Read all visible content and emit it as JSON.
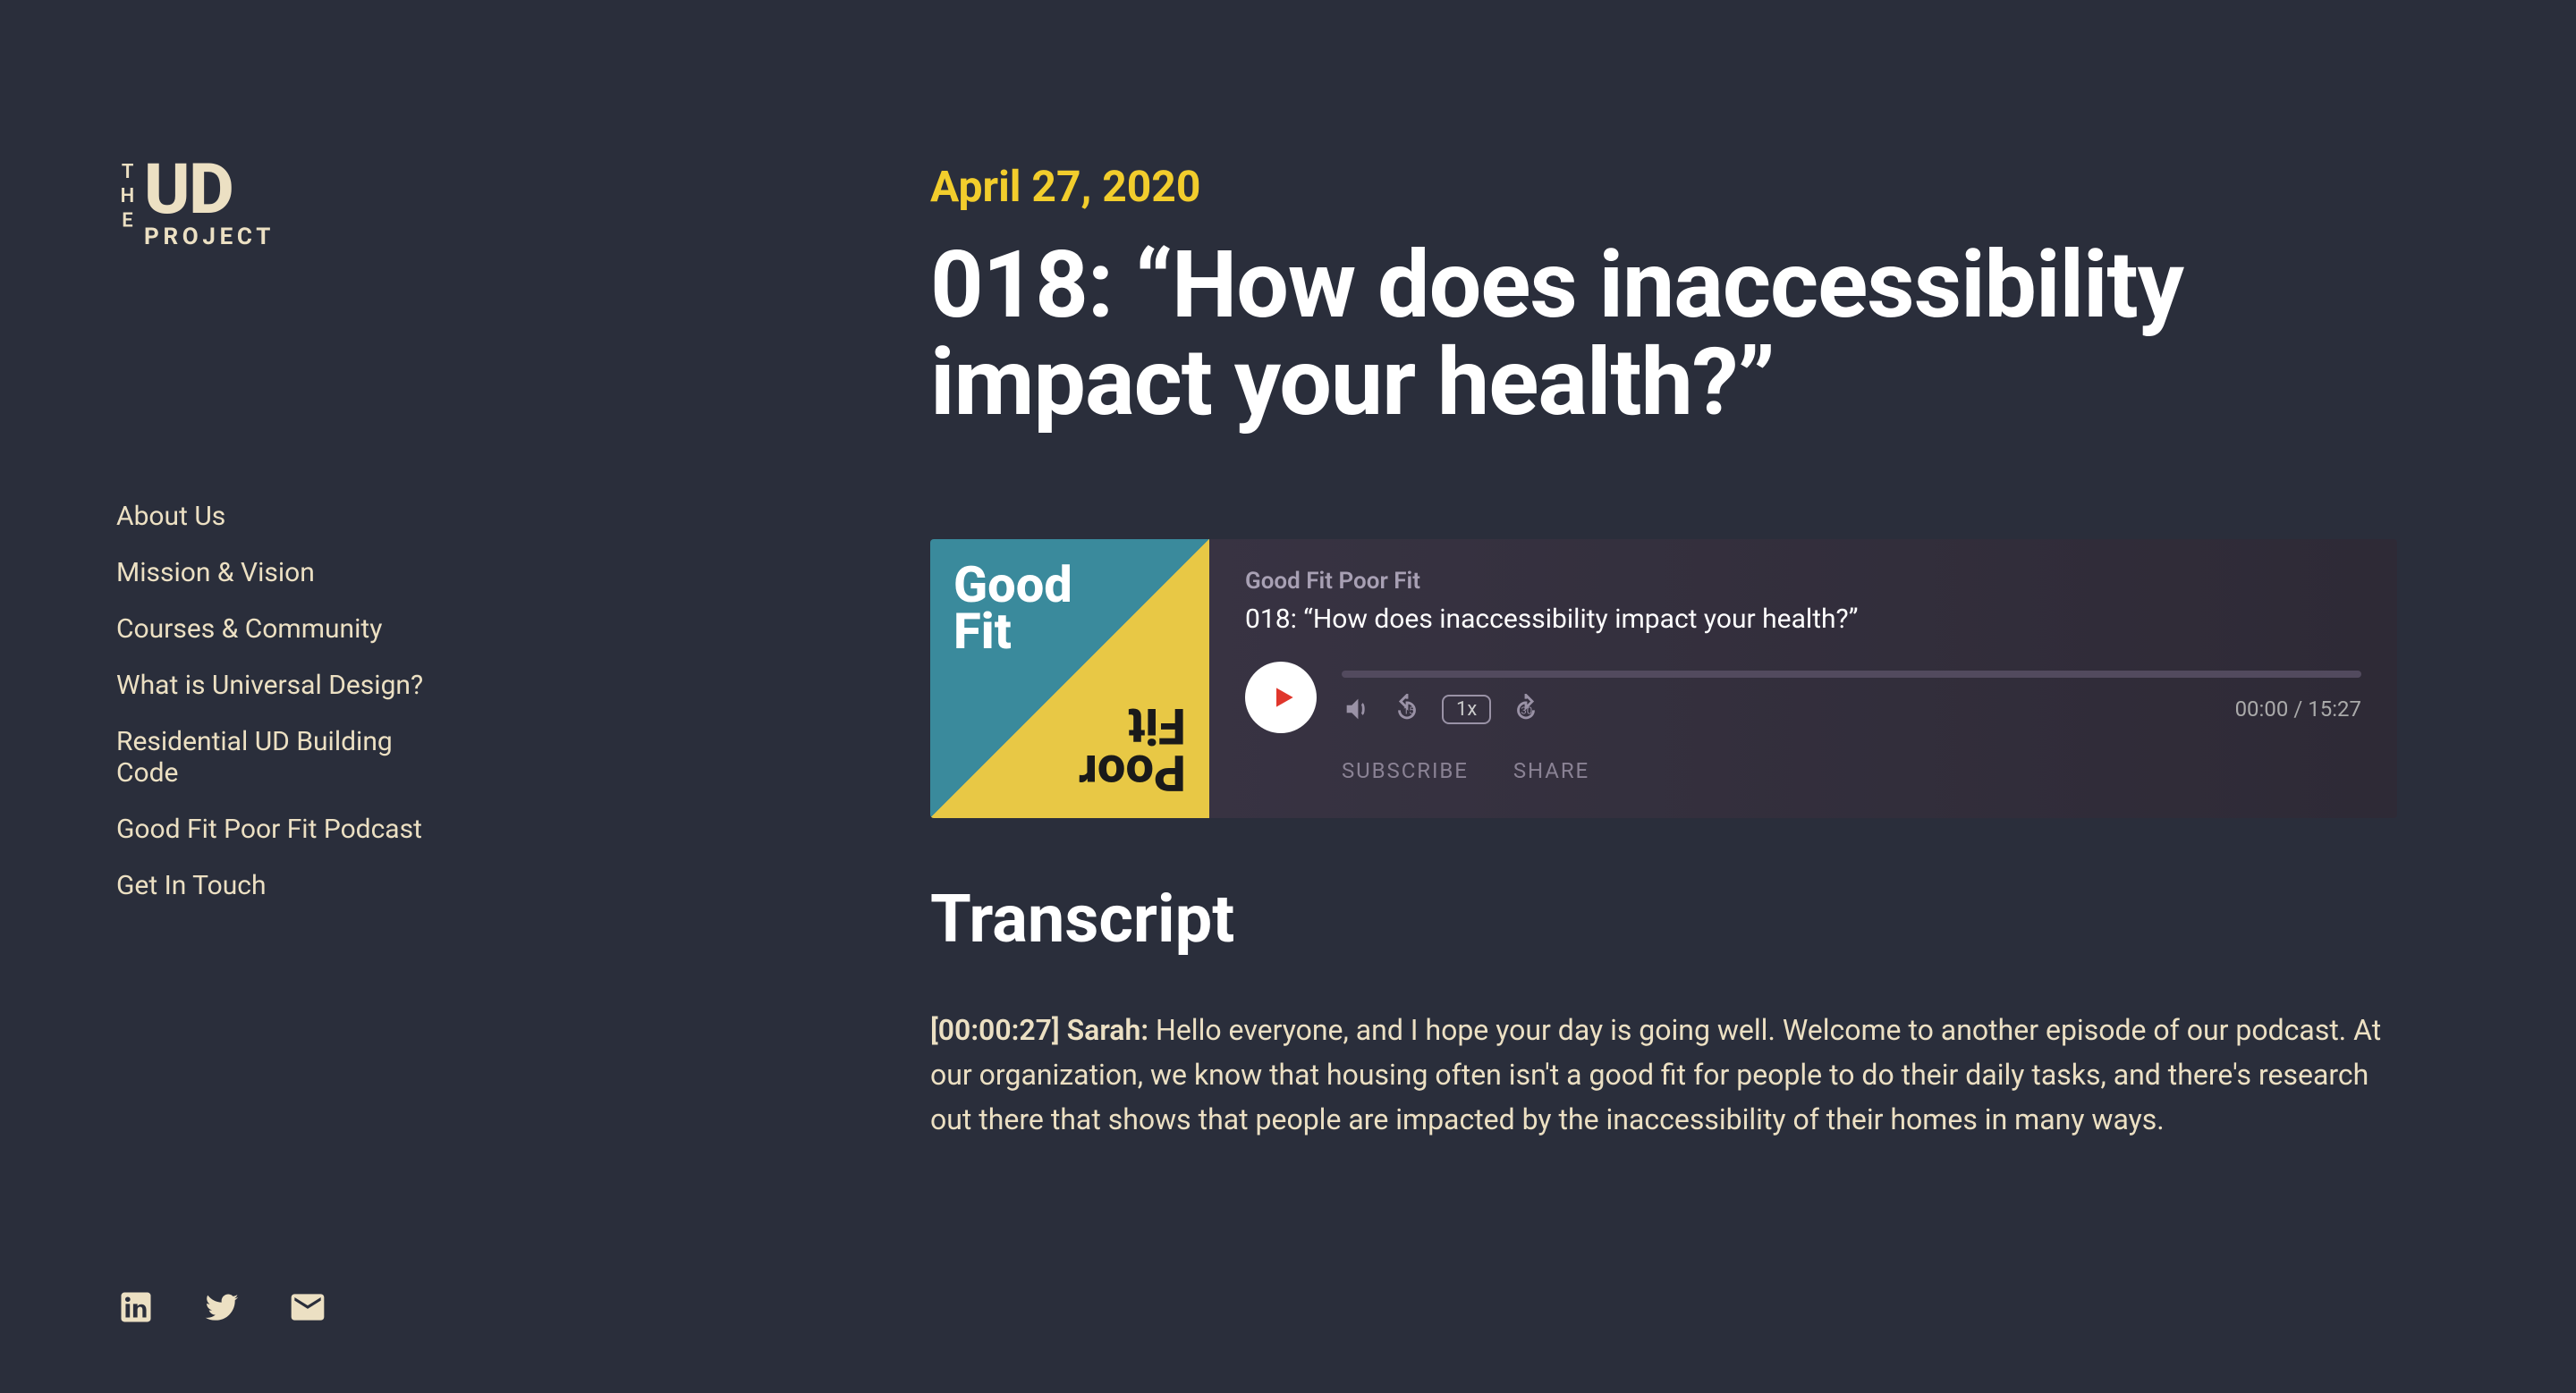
{
  "logo": {
    "the": "THE",
    "ud": "UD",
    "project": "PROJECT"
  },
  "nav": [
    "About Us",
    "Mission & Vision",
    "Courses & Community",
    "What is Universal Design?",
    "Residential UD Building Code",
    "Good Fit Poor Fit Podcast",
    "Get In Touch"
  ],
  "article": {
    "date": "April 27, 2020",
    "title": "018: “How does inaccessibility impact your health?”"
  },
  "player": {
    "podcast_name": "Good Fit Poor Fit",
    "episode_title": "018: “How does inaccessibility impact your health?”",
    "art_top": "Good\nFit",
    "art_bot": "Poor\nFit",
    "speed": "1x",
    "time_current": "00:00",
    "time_total": "15:27",
    "subscribe": "SUBSCRIBE",
    "share": "SHARE"
  },
  "transcript": {
    "heading": "Transcript",
    "first_timestamp": "[00:00:27]",
    "first_speaker": "Sarah:",
    "first_body": "  Hello everyone, and I hope your day is going well. Welcome to another episode of our podcast. At our organization, we know that housing often isn't a good fit for people to do their daily tasks, and there's research out there that shows that people are impacted by the inaccessibility of their homes in many ways."
  }
}
